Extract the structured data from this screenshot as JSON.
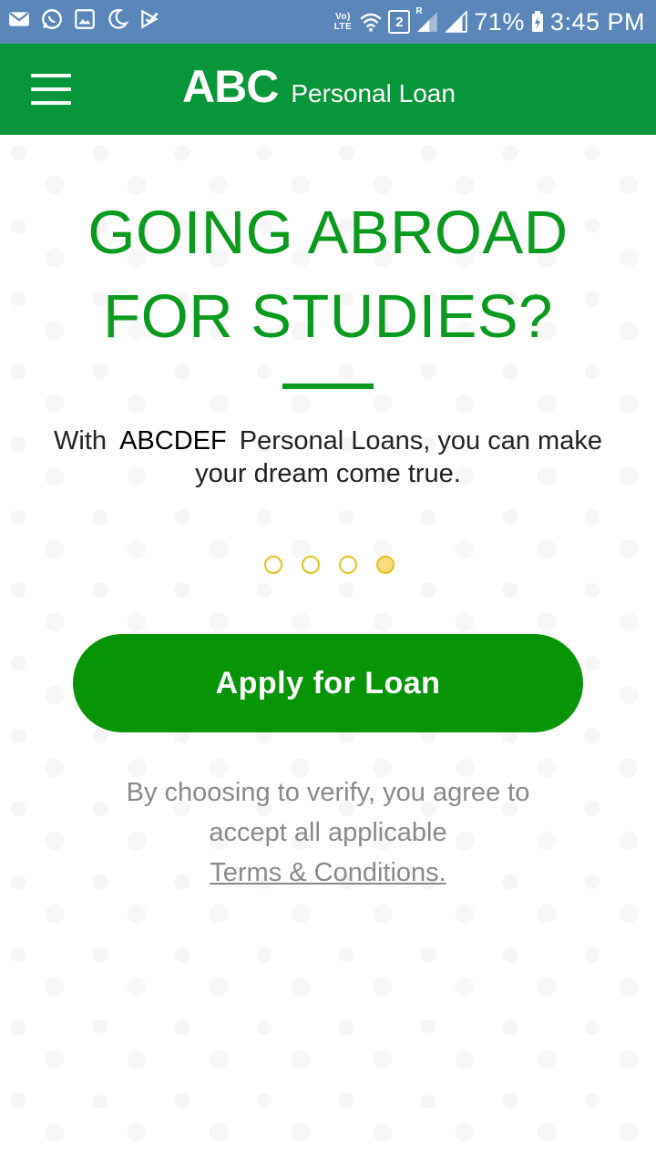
{
  "status_bar": {
    "left_icons": [
      "mail-icon",
      "whatsapp-icon",
      "gallery-icon",
      "moon-icon",
      "check-icon"
    ],
    "volte_label": "Vo) LTE",
    "sim_label": "2",
    "roaming_label": "R",
    "battery_percent": "71%",
    "time": "3:45 PM"
  },
  "app_bar": {
    "menu_icon": "hamburger-menu-icon",
    "logo_text": "ABC",
    "subtitle": "Personal Loan"
  },
  "hero": {
    "headline_line1": "GOING ABROAD",
    "headline_line2": "FOR STUDIES?",
    "tagline_prefix": "With",
    "tagline_brand": "ABCDEF",
    "tagline_suffix": "Personal Loans, you can make your dream come true."
  },
  "carousel": {
    "total": 4,
    "active_index": 3
  },
  "cta": {
    "label": "Apply for Loan"
  },
  "disclaimer": {
    "text_line1": "By choosing to verify, you agree to",
    "text_line2": "accept all applicable",
    "link_text": "Terms & Conditions."
  },
  "colors": {
    "status_bar": "#5a86b9",
    "app_bar": "#08963a",
    "headline": "#0a9a1e",
    "button": "#079407",
    "dot_border": "#e6c21a",
    "dot_active_fill": "#f6de80",
    "disclaimer": "#8a8a8a"
  }
}
